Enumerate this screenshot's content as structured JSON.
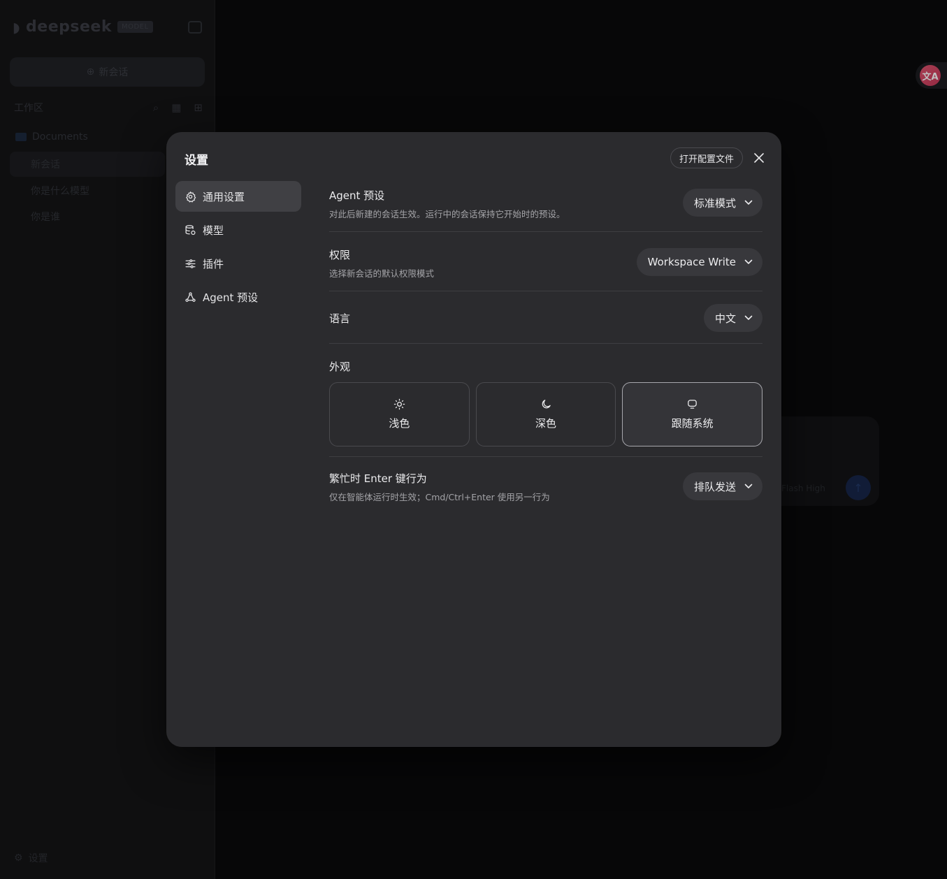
{
  "background": {
    "brand": "deepseek",
    "brand_badge": "MODEL",
    "new_chat_label": "新会话",
    "workspace_label": "工作区",
    "folder_label": "Documents",
    "sessions": [
      "新会话",
      "你是什么模型",
      "你是谁"
    ],
    "footer_label": "设置",
    "composer_model": "Flash High"
  },
  "modal": {
    "title": "设置",
    "open_config_label": "打开配置文件",
    "nav": [
      {
        "label": "通用设置",
        "icon": "gear-icon",
        "active": true
      },
      {
        "label": "模型",
        "icon": "database-icon",
        "active": false
      },
      {
        "label": "插件",
        "icon": "sliders-icon",
        "active": false
      },
      {
        "label": "Agent 预设",
        "icon": "agent-icon",
        "active": false
      }
    ],
    "settings": {
      "agent_preset": {
        "title": "Agent 预设",
        "desc": "对此后新建的会话生效。运行中的会话保持它开始时的预设。",
        "value": "标准模式"
      },
      "permission": {
        "title": "权限",
        "desc": "选择新会话的默认权限模式",
        "value": "Workspace Write"
      },
      "language": {
        "title": "语言",
        "value": "中文"
      },
      "appearance": {
        "title": "外观",
        "options": [
          {
            "label": "浅色",
            "icon": "sun-icon",
            "selected": false
          },
          {
            "label": "深色",
            "icon": "moon-icon",
            "selected": false
          },
          {
            "label": "跟随系统",
            "icon": "monitor-icon",
            "selected": true
          }
        ]
      },
      "busy_enter": {
        "title": "繁忙时 Enter 键行为",
        "desc": "仅在智能体运行时生效；Cmd/Ctrl+Enter 使用另一行为",
        "value": "排队发送"
      }
    }
  }
}
